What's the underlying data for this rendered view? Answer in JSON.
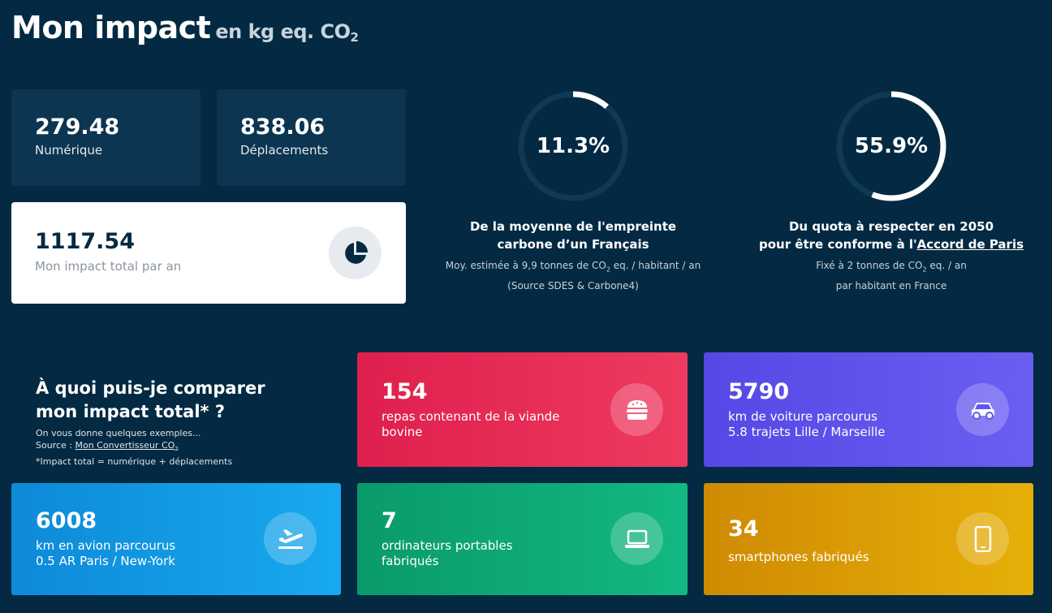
{
  "header": {
    "title": "Mon impact",
    "unit": "en kg eq. CO",
    "unit_sub": "2"
  },
  "stats": {
    "numerique": {
      "value": "279.48",
      "label": "Numérique"
    },
    "deplacements": {
      "value": "838.06",
      "label": "Déplacements"
    },
    "total": {
      "value": "1117.54",
      "label": "Mon impact total par an"
    }
  },
  "gauges": [
    {
      "percent": "11.3%",
      "fraction": 0.113,
      "line1": "De la moyenne de l'empreinte",
      "line2": "carbone d’un Français",
      "sub1_a": "Moy. estimée à 9,9 tonnes de CO",
      "sub1_sub": "2",
      "sub1_b": " eq. / habitant / an",
      "sub2": "(Source SDES & Carbone4)"
    },
    {
      "percent": "55.9%",
      "fraction": 0.559,
      "line1": "Du quota à respecter en 2050",
      "line2_a": "pour être conforme à l'",
      "line2_link": "Accord de Paris",
      "sub1_a": "Fixé à 2 tonnes de CO",
      "sub1_sub": "2",
      "sub1_b": " eq. / an",
      "sub2": "par habitant en France"
    }
  ],
  "compare": {
    "question_1": "À quoi puis-je comparer",
    "question_2": "mon impact total* ?",
    "examples": "On vous donne quelques exemples...",
    "source_label": "Source : ",
    "source_link": "Mon Convertisseur CO",
    "source_sub": "2",
    "footnote": "*Impact total = numérique + déplacements"
  },
  "cards": {
    "meat": {
      "value": "154",
      "line1": "repas contenant de la viande",
      "line2": "bovine",
      "icon": "burger-icon",
      "color": "#df1f4d"
    },
    "car": {
      "value": "5790",
      "line1": "km de voiture parcourus",
      "line2": "5.8 trajets Lille / Marseille",
      "icon": "car-icon",
      "color": "#5548e5"
    },
    "plane": {
      "value": "6008",
      "line1": "km en avion parcourus",
      "line2": "0.5 AR Paris / New-York",
      "icon": "airplane-icon",
      "color": "#0d8ad8"
    },
    "laptop": {
      "value": "7",
      "line1": "ordinateurs portables",
      "line2": "fabriqués",
      "icon": "laptop-icon",
      "color": "#0a9a6a"
    },
    "phone": {
      "value": "34",
      "line1": "smartphones fabriqués",
      "icon": "smartphone-icon",
      "color": "#cf8a03"
    }
  }
}
